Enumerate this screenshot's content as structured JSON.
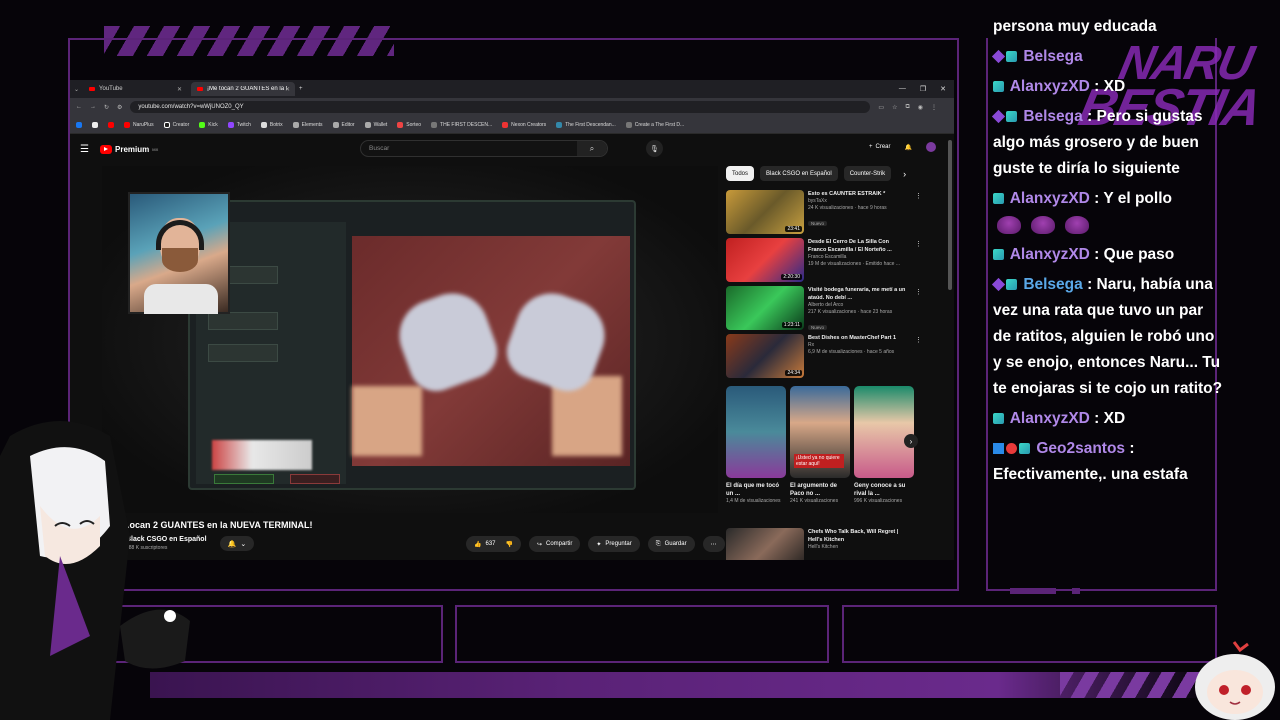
{
  "browser": {
    "tabs": [
      {
        "label": "YouTube"
      },
      {
        "label": "¡Me tocan 2 GUANTES en la N..."
      }
    ],
    "url": "youtube.com/watch?v=wWjUNOZ0_QY",
    "bookmarks": [
      "NaruPlus",
      "Creator",
      "Kick",
      "Twitch",
      "Botrix",
      "Elements",
      "Editor",
      "Wallet",
      "Sorteo",
      "THE FIRST DESCEN...",
      "Nexon Creators",
      "The First Descendan...",
      "Create a The First D..."
    ]
  },
  "youtube": {
    "logo_text": "Premium",
    "logo_region": "MX",
    "search_placeholder": "Buscar",
    "create_label": "Crear",
    "video": {
      "title": "...ocan 2 GUANTES en la NUEVA TERMINAL!",
      "channel": "Black CSGO en Español",
      "subscribers": "488 K suscriptores",
      "likes": "637",
      "share_label": "Compartir",
      "ask_label": "Preguntar",
      "save_label": "Guardar"
    },
    "chips": [
      "Todos",
      "Black CSGO en Español",
      "Counter-Strik"
    ],
    "recommendations": [
      {
        "title": "Esto es CAUNTER ESTRAIK *",
        "channel": "bysTaXx",
        "views": "24 K visualizaciones · hace 9 horas",
        "badge": "Nuevo",
        "duration": "23:41"
      },
      {
        "title": "Desde El Cerro De La Silla Con Franco Escamilla / El Norteño ...",
        "channel": "Franco Escamilla",
        "views": "19 M de visualizaciones · Emitido hace ...",
        "badge": "",
        "duration": "2:20:30"
      },
      {
        "title": "Visité bodega funeraria, me metí a un ataúd. No debí ...",
        "channel": "Alberto del Arco",
        "views": "217 K visualizaciones · hace 23 horas",
        "badge": "Nuevo",
        "duration": "1:23:11"
      },
      {
        "title": "Best Dishes on MasterChef Part 1",
        "channel": "Rx",
        "views": "6,9 M de visualizaciones · hace 5 años",
        "badge": "",
        "duration": "24:34"
      }
    ],
    "shorts": [
      {
        "title": "El día que me tocó un ...",
        "views": "1,4 M de visualizaciones"
      },
      {
        "title": "El argumento de Paco no ...",
        "views": "241 K visualizaciones"
      },
      {
        "title": "Geny conoce a su rival la ...",
        "views": "996 K visualizaciones"
      }
    ],
    "short_overlay": "¡Usted ya no quiere estar aquí!",
    "last_rec": {
      "title": "Chefs Who Talk Back, Will Regret | Hell's Kitchen",
      "channel": "Hell's Kitchen"
    }
  },
  "chat": {
    "messages": [
      {
        "user": "",
        "text": "persona muy educada"
      },
      {
        "user": "Belsega",
        "text": ""
      },
      {
        "user": "AlanxyzXD",
        "text": " : XD"
      },
      {
        "user": "Belsega",
        "text": " : Pero si gustas algo más grosero y de buen guste te diría lo siguiente"
      },
      {
        "user": "AlanxyzXD",
        "text": " : Y el pollo"
      },
      {
        "user": "AlanxyzXD",
        "text": " : Que paso"
      },
      {
        "user": "Belsega",
        "text": " : Naru, había una vez una rata que tuvo un par de ratitos, alguien le robó uno y se enojo, entonces Naru... Tu te enojaras si te cojo un ratito?"
      },
      {
        "user": "AlanxyzXD",
        "text": " : XD"
      },
      {
        "user": "Geo2santos",
        "text": " : Efectivamente,. una estafa"
      }
    ]
  },
  "brand": {
    "line1": "NARU",
    "line2": "BESTIA"
  },
  "colors": {
    "accent": "#5b2478",
    "brand": "#8a2ab8",
    "yt_red": "#ff0000"
  }
}
